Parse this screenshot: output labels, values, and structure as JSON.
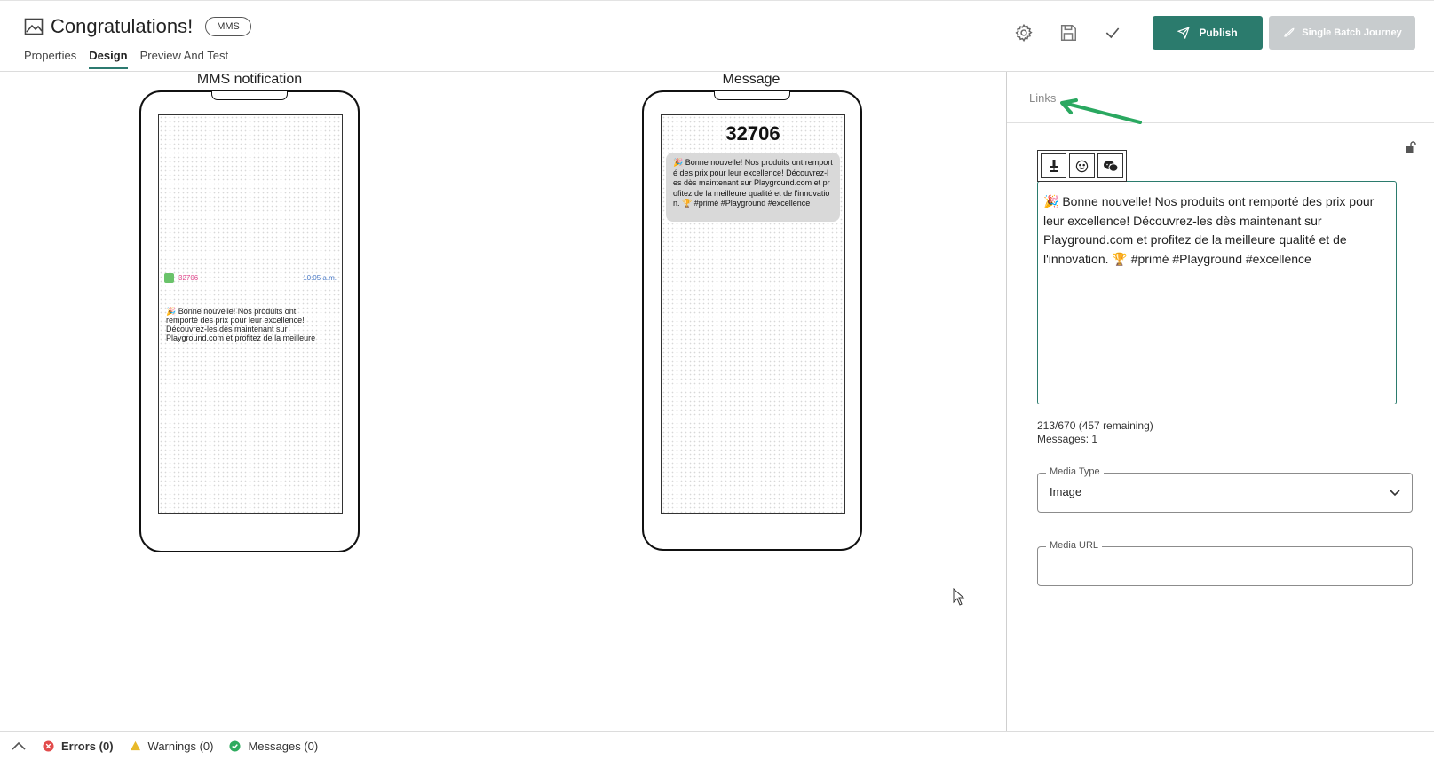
{
  "header": {
    "title": "Congratulations!",
    "badge": "MMS",
    "tabs": [
      {
        "label": "Properties"
      },
      {
        "label": "Design"
      },
      {
        "label": "Preview And Test"
      }
    ],
    "active_tab": "Design",
    "toolbar": {
      "icons": [
        "gear-icon",
        "save-icon",
        "check-icon"
      ],
      "publish_label": "Publish",
      "single_batch_label": "Single Batch Journey"
    }
  },
  "preview": {
    "left_phone": {
      "label": "MMS notification",
      "sender": "32706",
      "time": "10:05 a.m.",
      "body": "🎉 Bonne nouvelle! Nos produits ont remporté des prix pour leur excellence! Découvrez-les dès maintenant sur Playground.com et profitez de la meilleure"
    },
    "right_phone": {
      "label": "Message",
      "number": "32706",
      "bubble": "🎉 Bonne nouvelle! Nos produits ont remporté des prix pour leur excellence! Découvrez-les dès maintenant sur Playground.com et profitez de la meilleure qualité et de l'innovation. 🏆 #primé #Playground #excellence"
    }
  },
  "panel": {
    "links_label": "Links",
    "editor_text": "🎉 Bonne nouvelle! Nos produits ont remporté des prix pour leur excellence! Découvrez-les dès maintenant sur Playground.com et profitez de la meilleure qualité et de l'innovation. 🏆 #primé #Playground #excellence",
    "counter_chars": "213/670 (457 remaining)",
    "counter_messages": "Messages: 1",
    "media_type_label": "Media Type",
    "media_type_value": "Image",
    "media_url_label": "Media URL",
    "media_url_value": ""
  },
  "footer": {
    "errors": "Errors (0)",
    "warnings": "Warnings (0)",
    "messages": "Messages (0)"
  },
  "colors": {
    "primary": "#2b7b6d",
    "disabled": "#c8ccce",
    "arrow": "#2aa860",
    "error": "#e24c4c",
    "warning": "#e8b92a",
    "success": "#2eab5e"
  }
}
